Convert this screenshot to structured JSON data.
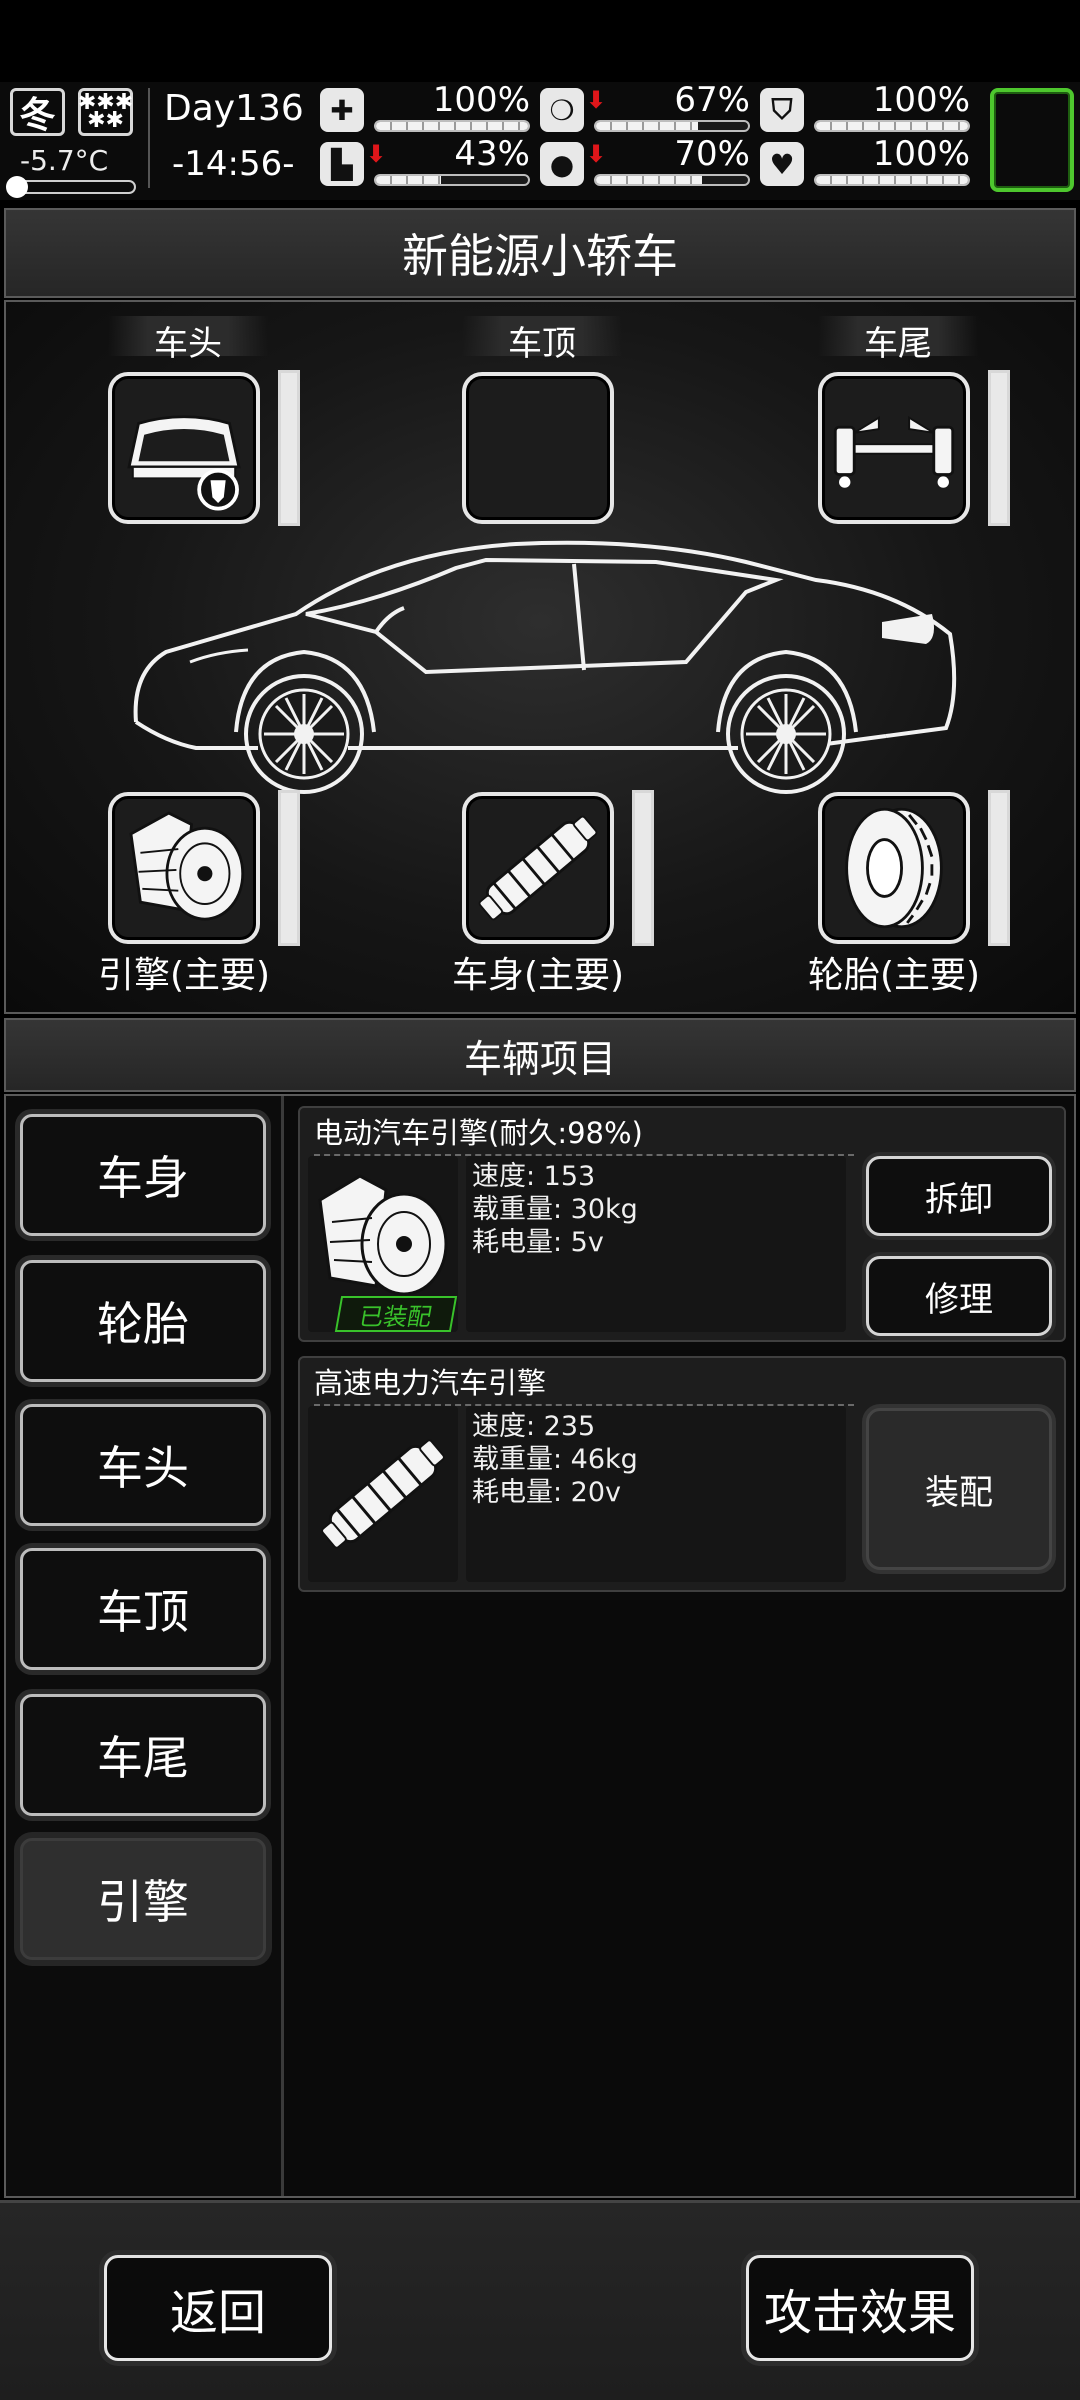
{
  "hud": {
    "season": "冬",
    "weather_icon": "snowflakes-icon",
    "temperature": "-5.7°C",
    "temperature_level": 0.05,
    "day": "Day136",
    "time": "-14:56-",
    "stats": [
      {
        "id": "health",
        "icon": "medkit-icon",
        "percent": "100%",
        "level": 1.0,
        "falling": false
      },
      {
        "id": "hunger",
        "icon": "stomach-icon",
        "percent": "67%",
        "level": 0.67,
        "falling": true
      },
      {
        "id": "armor",
        "icon": "shield-icon",
        "percent": "100%",
        "level": 1.0,
        "falling": false
      },
      {
        "id": "stamina",
        "icon": "boot-icon",
        "percent": "43%",
        "level": 0.43,
        "falling": true
      },
      {
        "id": "thirst",
        "icon": "water-drop-icon",
        "percent": "70%",
        "level": 0.7,
        "falling": true
      },
      {
        "id": "mood",
        "icon": "heart-icon",
        "percent": "100%",
        "level": 1.0,
        "falling": false
      }
    ]
  },
  "vehicle": {
    "name": "新能源小轿车",
    "slots_top": [
      {
        "label": "车头",
        "icon": "car-front-bumper-icon"
      },
      {
        "label": "车顶",
        "icon": "empty-slot"
      },
      {
        "label": "车尾",
        "icon": "rear-axle-icon"
      }
    ],
    "slots_bottom": [
      {
        "label": "引擎(主要)",
        "icon": "electric-motor-icon"
      },
      {
        "label": "车身(主要)",
        "icon": "car-body-frame-icon"
      },
      {
        "label": "轮胎(主要)",
        "icon": "tire-icon"
      }
    ]
  },
  "items_section": {
    "title": "车辆项目",
    "categories": [
      "车身",
      "轮胎",
      "车头",
      "车顶",
      "车尾",
      "引擎"
    ],
    "active_category": "引擎",
    "items": [
      {
        "name": "电动汽车引擎(耐久:98%)",
        "icon": "electric-motor-icon",
        "equipped_label": "已装配",
        "stats": [
          "速度: 153",
          "载重量: 30kg",
          "耗电量: 5v"
        ],
        "actions": [
          "拆卸",
          "修理"
        ]
      },
      {
        "name": "高速电力汽车引擎",
        "icon": "high-speed-motor-icon",
        "stats": [
          "速度: 235",
          "载重量: 46kg",
          "耗电量: 20v"
        ],
        "actions": [
          "装配"
        ]
      }
    ]
  },
  "footer": {
    "back_label": "返回",
    "attack_effect_label": "攻击效果"
  },
  "colors": {
    "equipped_green": "#39c22b",
    "selected_slot_green": "#4ec72e",
    "falling_arrow_red": "#e0161a"
  }
}
